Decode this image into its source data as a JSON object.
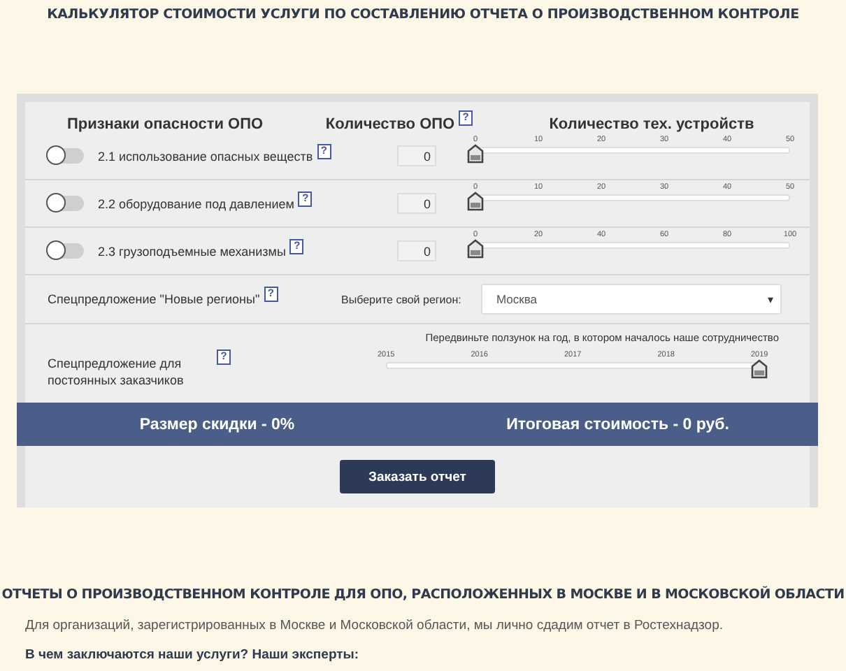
{
  "title": "КАЛЬКУЛЯТОР СТОИМОСТИ УСЛУГИ ПО СОСТАВЛЕНИЮ ОТЧЕТА О ПРОИЗВОДСТВЕННОМ КОНТРОЛЕ",
  "hazard_table": {
    "headers": [
      {
        "label": "Признаки опасности ОПО"
      },
      {
        "label": "Количество ОПО",
        "help": "?"
      },
      {
        "label": "Количество тех. устройств"
      }
    ],
    "rows": [
      {
        "on": false,
        "label": "2.1 использование опасных веществ",
        "help": "?",
        "count": "0",
        "slider": {
          "ticks": [
            "0",
            "10",
            "20",
            "30",
            "40",
            "50"
          ],
          "level": 0
        }
      },
      {
        "on": false,
        "label": "2.2 оборудование под давлением",
        "help": "?",
        "count": "0",
        "slider": {
          "ticks": [
            "0",
            "10",
            "20",
            "30",
            "40",
            "50"
          ],
          "level": 0
        }
      },
      {
        "on": false,
        "label": "2.3 грузоподъемные механизмы",
        "help": "?",
        "count": "0",
        "slider": {
          "ticks": [
            "0",
            "20",
            "40",
            "60",
            "80",
            "100"
          ],
          "level": 0
        }
      }
    ]
  },
  "region_offer": {
    "label": "Спецпредложение \"Новые регионы\"",
    "help": "?",
    "select_label": "Выберите свой регион:",
    "value": "Москва",
    "caret": "▾"
  },
  "loyalty_offer": {
    "label": "Спецпредложение для постоянных заказчиков",
    "help": "?",
    "hint": "Передвиньте ползунок на год, в котором началось наше сотрудничество",
    "ticks": [
      "2015",
      "2016",
      "2017",
      "2018",
      "2019"
    ],
    "level": 1
  },
  "summary": {
    "discount": "Размер скидки - 0%",
    "total": "Итоговая стоимость - 0 руб."
  },
  "order_button": "Заказать отчет",
  "section": {
    "heading": "ОТЧЕТЫ О ПРОИЗВОДСТВЕННОМ КОНТРОЛЕ ДЛЯ ОПО, РАСПОЛОЖЕННЫХ В МОСКВЕ И В МОСКОВСКОЙ ОБЛАСТИ",
    "paragraph": "Для организаций, зарегистрированных в Москве и Московской области, мы лично сдадим отчет в Ростехнадзор.",
    "question": "В чем заключаются наши услуги? Наши эксперты:"
  }
}
